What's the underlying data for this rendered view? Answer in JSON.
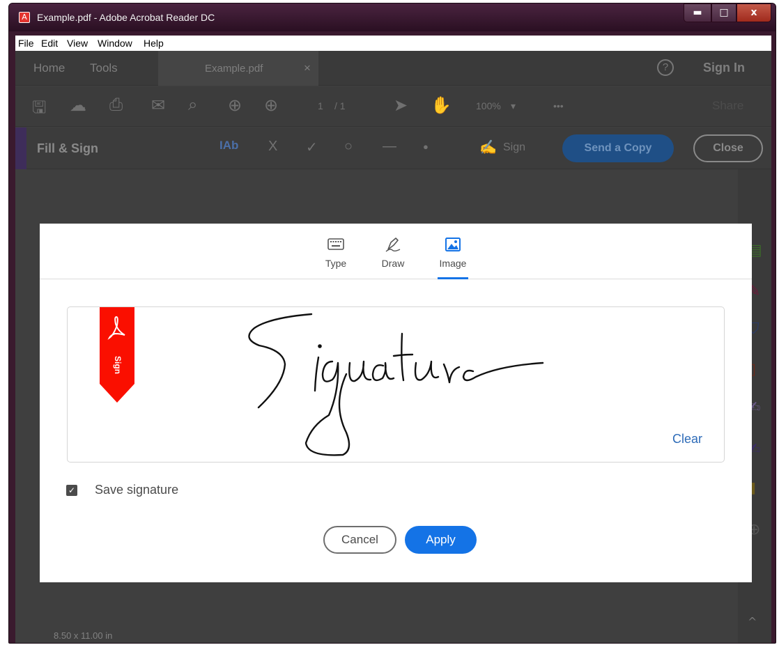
{
  "window": {
    "title": "Example.pdf - Adobe Acrobat Reader DC",
    "min_glyph": "▬",
    "max_glyph": "□",
    "close_glyph": "x"
  },
  "menu": [
    "File",
    "Edit",
    "View",
    "Window",
    "Help"
  ],
  "tabs": {
    "home": "Home",
    "tools": "Tools",
    "document": "Example.pdf",
    "close_glyph": "×",
    "sign_in": "Sign In",
    "help_glyph": "?"
  },
  "toolbar": {
    "page_current": "1",
    "page_total": "/ 1",
    "zoom": "100%",
    "zoom_caret": "▾",
    "more": "•••",
    "share": "Share"
  },
  "fill_sign": {
    "title": "Fill & Sign",
    "text_tool": "Ab",
    "cross_tool": "X",
    "check_tool": "✓",
    "circle_tool": "○",
    "line_tool": "—",
    "dot_tool": "●",
    "sign_label": "Sign",
    "send_copy": "Send a Copy",
    "close": "Close"
  },
  "status": {
    "page_size": "8.50 x 11.00 in"
  },
  "dialog": {
    "tabs": [
      {
        "label": "Type",
        "icon": "keyboard-icon"
      },
      {
        "label": "Draw",
        "icon": "pen-icon"
      },
      {
        "label": "Image",
        "icon": "image-icon"
      }
    ],
    "active_tab": "Image",
    "ribbon_text": "Sign",
    "clear": "Clear",
    "save_signature": {
      "label": "Save signature",
      "checked": true
    },
    "cancel": "Cancel",
    "apply": "Apply"
  },
  "colors": {
    "accent_blue": "#1473e6",
    "acrobat_red": "#fa0f00"
  }
}
